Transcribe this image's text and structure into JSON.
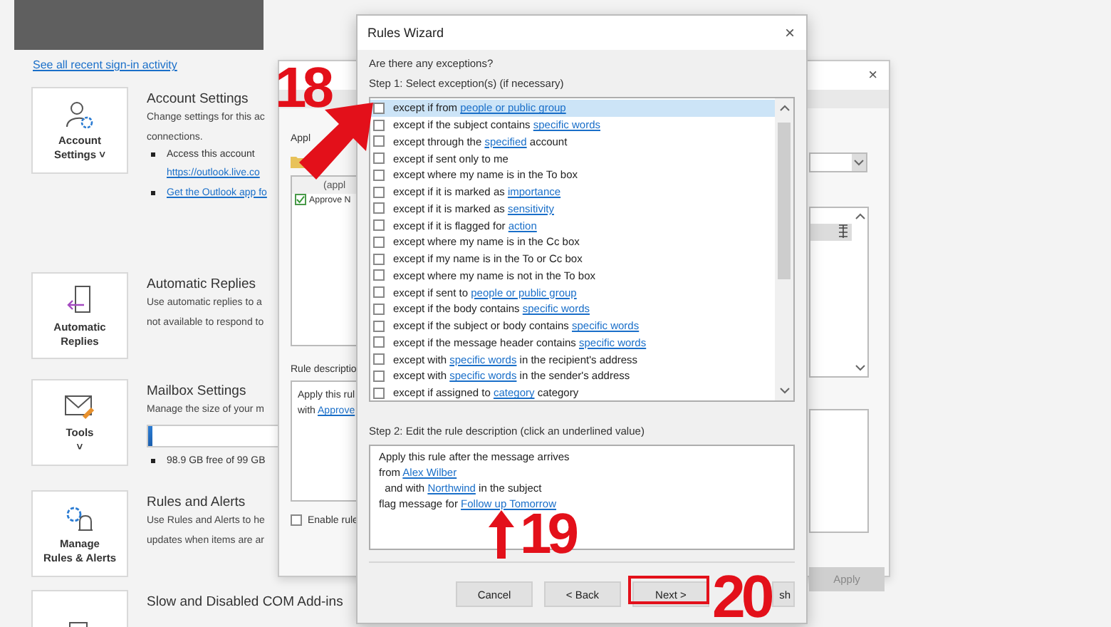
{
  "account_pane": {
    "sign_in_link": "See all recent sign-in activity",
    "sections": [
      {
        "kind": "account",
        "card_lines": [
          "Account",
          "Settings ˅"
        ],
        "title": "Account Settings",
        "description": [
          "Change settings for this ac",
          "connections."
        ],
        "bullets": [
          {
            "text": "Access this account",
            "link": false,
            "bullet": true
          },
          {
            "text": "https://outlook.live.co",
            "link": true,
            "bullet": false
          },
          {
            "text": "Get the Outlook app fo",
            "link": true,
            "bullet": true
          }
        ]
      },
      {
        "kind": "replies",
        "card_lines": [
          "Automatic",
          "Replies"
        ],
        "title": "Automatic Replies",
        "description": [
          "Use automatic replies to a",
          "not available to respond to"
        ]
      },
      {
        "kind": "tools",
        "card_lines": [
          "Tools",
          "˅"
        ],
        "title": "Mailbox Settings",
        "description": [
          "Manage the size of your m"
        ],
        "level": 0.03,
        "bullets": [
          {
            "text": "98.9 GB free of 99 GB",
            "link": false,
            "bullet": true
          }
        ]
      },
      {
        "kind": "rules",
        "card_lines": [
          "Manage",
          "Rules & Alerts"
        ],
        "title": "Rules and Alerts",
        "description": [
          "Use Rules and Alerts to he",
          "updates when items are ar"
        ]
      },
      {
        "kind": "addins",
        "title": "Slow and Disabled COM Add-ins"
      }
    ]
  },
  "rules_dialog": {
    "close_label": "×",
    "cut_label": "Appl",
    "list_header": "(appl",
    "rules": [
      {
        "name": "Approve N",
        "checked": true
      }
    ],
    "description_label": "Rule descriptio",
    "description": [
      [
        {
          "text": "Apply this rul",
          "link": false
        }
      ],
      [
        {
          "text": "with ",
          "link": false
        },
        {
          "text": "Approve",
          "link": true
        }
      ]
    ],
    "enable_label": "Enable rule",
    "enable_checked": false,
    "apply_button": {
      "label": "Apply",
      "disabled": true
    }
  },
  "wizard": {
    "title": "Rules Wizard",
    "close_label": "×",
    "question": "Are there any exceptions?",
    "step1": "Step 1: Select exception(s) (if necessary)",
    "exceptions": [
      {
        "selected": true,
        "checked": false,
        "parts": [
          {
            "text": "except if from ",
            "link": false
          },
          {
            "text": "people or public group",
            "link": true
          }
        ]
      },
      {
        "selected": false,
        "checked": false,
        "parts": [
          {
            "text": "except if the subject contains ",
            "link": false
          },
          {
            "text": "specific words",
            "link": true
          }
        ]
      },
      {
        "selected": false,
        "checked": false,
        "parts": [
          {
            "text": "except through the ",
            "link": false
          },
          {
            "text": "specified",
            "link": true
          },
          {
            "text": " account",
            "link": false
          }
        ]
      },
      {
        "selected": false,
        "checked": false,
        "parts": [
          {
            "text": "except if sent only to me",
            "link": false
          }
        ]
      },
      {
        "selected": false,
        "checked": false,
        "parts": [
          {
            "text": "except where my name is in the To box",
            "link": false
          }
        ]
      },
      {
        "selected": false,
        "checked": false,
        "parts": [
          {
            "text": "except if it is marked as ",
            "link": false
          },
          {
            "text": "importance",
            "link": true
          }
        ]
      },
      {
        "selected": false,
        "checked": false,
        "parts": [
          {
            "text": "except if it is marked as ",
            "link": false
          },
          {
            "text": "sensitivity",
            "link": true
          }
        ]
      },
      {
        "selected": false,
        "checked": false,
        "parts": [
          {
            "text": "except if it is flagged for ",
            "link": false
          },
          {
            "text": "action",
            "link": true
          }
        ]
      },
      {
        "selected": false,
        "checked": false,
        "parts": [
          {
            "text": "except where my name is in the Cc box",
            "link": false
          }
        ]
      },
      {
        "selected": false,
        "checked": false,
        "parts": [
          {
            "text": "except if my name is in the To or Cc box",
            "link": false
          }
        ]
      },
      {
        "selected": false,
        "checked": false,
        "parts": [
          {
            "text": "except where my name is not in the To box",
            "link": false
          }
        ]
      },
      {
        "selected": false,
        "checked": false,
        "parts": [
          {
            "text": "except if sent to ",
            "link": false
          },
          {
            "text": "people or public group",
            "link": true
          }
        ]
      },
      {
        "selected": false,
        "checked": false,
        "parts": [
          {
            "text": "except if the body contains ",
            "link": false
          },
          {
            "text": "specific words",
            "link": true
          }
        ]
      },
      {
        "selected": false,
        "checked": false,
        "parts": [
          {
            "text": "except if the subject or body contains ",
            "link": false
          },
          {
            "text": "specific words",
            "link": true
          }
        ]
      },
      {
        "selected": false,
        "checked": false,
        "parts": [
          {
            "text": "except if the message header contains ",
            "link": false
          },
          {
            "text": "specific words",
            "link": true
          }
        ]
      },
      {
        "selected": false,
        "checked": false,
        "parts": [
          {
            "text": "except with ",
            "link": false
          },
          {
            "text": "specific words",
            "link": true
          },
          {
            "text": " in the recipient's address",
            "link": false
          }
        ]
      },
      {
        "selected": false,
        "checked": false,
        "parts": [
          {
            "text": "except with ",
            "link": false
          },
          {
            "text": "specific words",
            "link": true
          },
          {
            "text": " in the sender's address",
            "link": false
          }
        ]
      },
      {
        "selected": false,
        "checked": false,
        "parts": [
          {
            "text": "except if assigned to ",
            "link": false
          },
          {
            "text": "category",
            "link": true
          },
          {
            "text": " category",
            "link": false
          }
        ]
      }
    ],
    "step2": "Step 2: Edit the rule description (click an underlined value)",
    "description": [
      [
        {
          "text": "Apply this rule after the message arrives",
          "link": false
        }
      ],
      [
        {
          "text": "from ",
          "link": false
        },
        {
          "text": "Alex Wilber",
          "link": true
        }
      ],
      [
        {
          "text": "  and with ",
          "link": false
        },
        {
          "text": "Northwind",
          "link": true
        },
        {
          "text": " in the subject",
          "link": false
        }
      ],
      [
        {
          "text": "flag message for ",
          "link": false
        },
        {
          "text": "Follow up Tomorrow",
          "link": true
        }
      ]
    ],
    "buttons": [
      {
        "kind": "labeled",
        "label": "Cancel"
      },
      {
        "kind": "labeled",
        "label": "< Back"
      },
      {
        "kind": "labeled",
        "label": "Next >"
      },
      {
        "kind": "covered",
        "label": "sh"
      }
    ]
  },
  "annotations": [
    {
      "label": "18",
      "kind": "diagonal"
    },
    {
      "label": "19",
      "kind": "up"
    },
    {
      "label": "20",
      "kind": "box"
    }
  ]
}
